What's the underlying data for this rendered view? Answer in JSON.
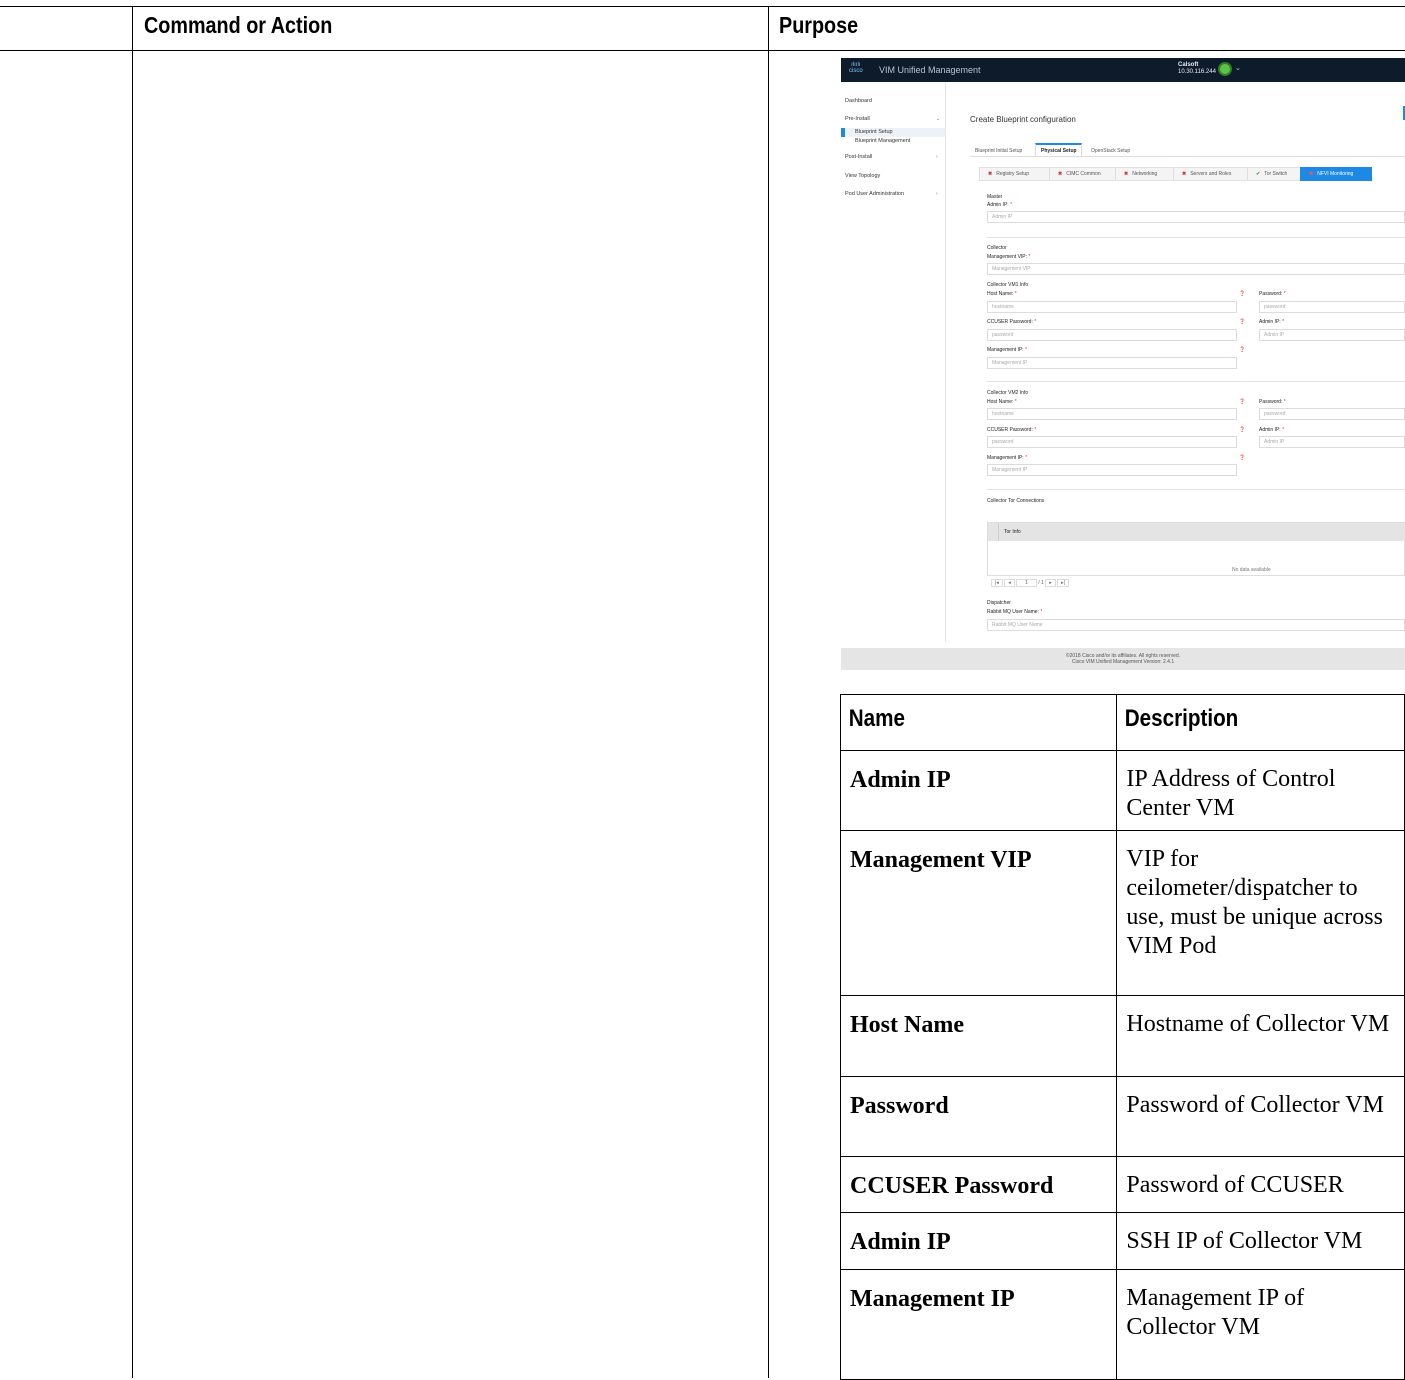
{
  "columns": {
    "command": "Command or Action",
    "purpose": "Purpose"
  },
  "screenshot": {
    "app_title": "VIM Unified Management",
    "account": {
      "name": "Calsoft",
      "ip": "10.30.116.244"
    },
    "sidebar": {
      "dashboard": "Dashboard",
      "pre_install": "Pre-Install",
      "blueprint_setup": "Blueprint Setup",
      "blueprint_management": "Blueprint Management",
      "post_install": "Post-Install",
      "view_topology": "View Topology",
      "pod_user_admin": "Pod User Administration"
    },
    "page_title": "Create Blueprint configuration",
    "tabs": [
      "Blueprint Initial Setup",
      "Physical Setup",
      "OpenStack Setup"
    ],
    "steps": [
      {
        "label": "Registry Setup",
        "status": "error"
      },
      {
        "label": "CIMC Common",
        "status": "error"
      },
      {
        "label": "Networking",
        "status": "error"
      },
      {
        "label": "Servers and Roles",
        "status": "error"
      },
      {
        "label": "Tor Switch",
        "status": "ok"
      },
      {
        "label": "NFVI Monitoring",
        "status": "error"
      }
    ],
    "form": {
      "master": "Master",
      "admin_ip_label": "Admin IP:",
      "admin_ip_ph": "Admin IP",
      "collector": "Collector",
      "mgmt_vip_label": "Management VIP:",
      "mgmt_vip_ph": "Management VIP",
      "vm1": "Collector VM1 Info",
      "vm2": "Collector VM2 Info",
      "host_name_label": "Host Name:",
      "host_name_ph": "hostname",
      "password_label": "Password:",
      "password_ph": "password",
      "ccuser_label": "CCUSER Password:",
      "ccuser_ph": "password",
      "vm_admin_ip_label": "Admin IP:",
      "vm_admin_ip_ph": "Admin IP",
      "mgmt_ip_label": "Management IP:",
      "mgmt_ip_ph": "Management IP",
      "tor_connections": "Collector Tor Connections",
      "tor_info": "Tor Info",
      "no_data": "No data available",
      "pager_page": "1",
      "pager_total": "/ 1",
      "dispatcher": "Dispatcher",
      "rabbit_label": "Rabbit MQ User Name:",
      "rabbit_ph": "Rabbit MQ User Name",
      "required_mark": "*"
    },
    "footer": {
      "line1": "©2018 Cisco and/or its affiliates. All rights reserved.",
      "line2": "Cisco VIM Unified Management Version: 2.4.1"
    }
  },
  "table": {
    "headers": [
      "Name",
      "Description"
    ],
    "rows": [
      {
        "name": "Admin IP",
        "desc": "IP Address of Control Center VM"
      },
      {
        "name": "Management VIP",
        "desc": "VIP for ceilometer/dispatcher to use, must be unique across VIM Pod"
      },
      {
        "name": "Host Name",
        "desc": "Hostname of Collector VM"
      },
      {
        "name": "Password",
        "desc": "Password of Collector VM"
      },
      {
        "name": "CCUSER Password",
        "desc": "Password of CCUSER"
      },
      {
        "name": "Admin IP",
        "desc": "SSH IP of Collector VM"
      },
      {
        "name": "Management IP",
        "desc": "Management IP of Collector VM"
      }
    ]
  }
}
